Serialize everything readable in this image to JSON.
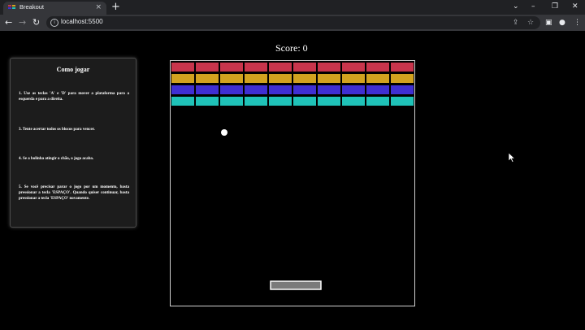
{
  "browser": {
    "tab_title": "Breakout",
    "tab_close": "×",
    "new_tab": "+",
    "url": "localhost:5500",
    "window_controls": [
      "⌄",
      "–",
      "❐",
      "✕"
    ],
    "nav_back": "←",
    "nav_forward": "→",
    "nav_reload": "↻",
    "toolbar_icons": [
      "share-icon",
      "star-icon",
      "sidebar-icon",
      "profile-icon",
      "menu-icon"
    ]
  },
  "game": {
    "score_label": "Score: 0",
    "instructions": {
      "title": "Como jogar",
      "rules": [
        "1. Use as teclas 'A' e 'D' para mover a plataforma para a esquerda e para a direita.",
        "3. Tente acertar todos os blocos para vencer.",
        "4. Se a bolinha atingir o chão, o jogo acaba.",
        "5. Se você precisar parar o jogo por um momento, basta pressionar a tecla 'ESPAÇO'. Quando quiser continuar, basta pressionar a tecla 'ESPAÇO' novamente."
      ]
    },
    "brick_rows": [
      {
        "color": "#c8354c",
        "count": 10
      },
      {
        "color": "#d2a21f",
        "count": 10
      },
      {
        "color": "#3f2fd2",
        "count": 10
      },
      {
        "color": "#1fc2b8",
        "count": 10
      }
    ],
    "ball_color": "#ffffff",
    "paddle_fill": "#7a7a7a",
    "paddle_border": "#ffffff",
    "board_border": "#d0d0d0"
  }
}
